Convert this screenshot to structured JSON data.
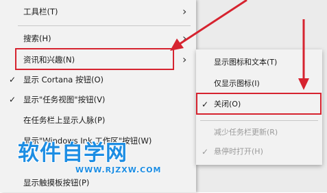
{
  "main_menu": {
    "items": [
      {
        "label": "工具栏(T)",
        "checked": false,
        "submenu": true
      },
      {
        "label": "搜索(H)",
        "checked": false,
        "submenu": true
      },
      {
        "label": "资讯和兴趣(N)",
        "checked": false,
        "submenu": true
      },
      {
        "label": "显示 Cortana 按钮(O)",
        "checked": true,
        "submenu": false
      },
      {
        "label": "显示\"任务视图\"按钮(V)",
        "checked": true,
        "submenu": false
      },
      {
        "label": "在任务栏上显示人脉(P)",
        "checked": false,
        "submenu": false
      },
      {
        "label": "显示\"Windows Ink 工作区\"按钮(W)",
        "checked": false,
        "submenu": false
      },
      {
        "label": "显示触摸板按钮(P)",
        "checked": false,
        "submenu": false
      }
    ],
    "check_glyph": "✓",
    "arrow_glyph": "›"
  },
  "sub_menu": {
    "items": [
      {
        "label": "显示图标和文本(T)",
        "checked": false,
        "disabled": false
      },
      {
        "label": "仅显示图标(I)",
        "checked": false,
        "disabled": false
      },
      {
        "label": "关闭(O)",
        "checked": true,
        "disabled": false
      },
      {
        "label": "减少任务栏更新(R)",
        "checked": false,
        "disabled": true
      },
      {
        "label": "悬停时打开(H)",
        "checked": true,
        "disabled": true
      }
    ]
  },
  "watermark": {
    "text": "软件自学网",
    "url": "WWW.RJZXW.COM"
  },
  "colors": {
    "highlight_red": "#d6232f",
    "watermark_blue": "#1c8de3"
  }
}
